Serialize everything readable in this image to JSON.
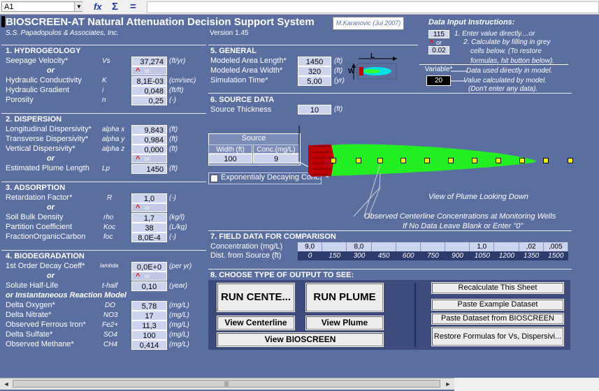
{
  "formula_bar": {
    "cell_ref": "A1",
    "dropdown": "▼",
    "fx_icon": "fx",
    "sum_icon": "Σ",
    "equals_icon": "="
  },
  "header": {
    "title": "BIOSCREEN-AT Natural Attenuation Decision Support System",
    "company": "S.S. Papadopulos & Associates, Inc.",
    "version": "Version 1.45",
    "author": "M.Karanovic (Jul 2007)"
  },
  "instructions": {
    "title": "Data Input Instructions:",
    "example_value": "115",
    "or": "or",
    "example_calc": "0.02",
    "step1": "1.  Enter value directly....or",
    "step2a": "2.  Calculate by filling in grey",
    "step2b": "cells below.  (To restore",
    "step2c": "formulas, hit button below).",
    "variable_label": "Variable*",
    "variable_note": "Data used directly in model.",
    "calc_value": "20",
    "calc_note1": "Value calculated by model.",
    "calc_note2": "(Don't enter any data)."
  },
  "hydrogeology": {
    "header": "1.  HYDROGEOLOGY",
    "seepage_label": "Seepage Velocity*",
    "seepage_sym": "Vs",
    "seepage_value": "37,274",
    "seepage_unit": "(ft/yr)",
    "or": "or",
    "or_small": "or",
    "conductivity_label": "Hydraulic Conductivity",
    "conductivity_sym": "K",
    "conductivity_value": "8,1E-03",
    "conductivity_unit": "(cm/sec)",
    "gradient_label": "Hydraulic Gradient",
    "gradient_sym": "i",
    "gradient_value": "0,048",
    "gradient_unit": "(ft/ft)",
    "porosity_label": "Porosity",
    "porosity_sym": "n",
    "porosity_value": "0,25",
    "porosity_unit": "(-)"
  },
  "dispersion": {
    "header": "2.  DISPERSION",
    "long_label": "Longitudinal Dispersivity*",
    "long_sym": "alpha x",
    "long_value": "9,843",
    "long_unit": "(ft)",
    "trans_label": "Transverse Dispersivity*",
    "trans_sym": "alpha y",
    "trans_value": "0,984",
    "trans_unit": "(ft)",
    "vert_label": "Vertical Dispersivity*",
    "vert_sym": "alpha z",
    "vert_value": "0,000",
    "vert_unit": "(ft)",
    "or": "or",
    "or_small": "or",
    "plume_label": "Estimated Plume Length",
    "plume_sym": "Lp",
    "plume_value": "1450",
    "plume_unit": "(ft)"
  },
  "adsorption": {
    "header": "3.  ADSORPTION",
    "retard_label": "Retardation Factor*",
    "retard_sym": "R",
    "retard_value": "1,0",
    "retard_unit": "(-)",
    "or": "or",
    "or_small": "or",
    "bulk_label": "Soil Bulk Density",
    "bulk_sym": "rho",
    "bulk_value": "1,7",
    "bulk_unit": "(kg/l)",
    "partition_label": "Partition Coefficient",
    "partition_sym": "Koc",
    "partition_value": "38",
    "partition_unit": "(L/kg)",
    "foc_label": "FractionOrganicCarbon",
    "foc_sym": "foc",
    "foc_value": "8,0E-4",
    "foc_unit": "(-)"
  },
  "biodegradation": {
    "header": "4.  BIODEGRADATION",
    "decay_label": "1st Order Decay Coeff*",
    "decay_sym": "lambda",
    "decay_value": "0,0E+0",
    "decay_unit": "(per yr)",
    "or": "or",
    "or_small": "or",
    "halflife_label": "Solute Half-Life",
    "halflife_sym": "t-half",
    "halflife_value": "0,10",
    "halflife_unit": "(year)",
    "inst_label": "or Instantaneous Reaction Model",
    "do_label": "Delta Oxygen*",
    "do_sym": "DO",
    "do_value": "5,78",
    "do_unit": "(mg/L)",
    "no3_label": "Delta Nitrate*",
    "no3_sym": "NO3",
    "no3_value": "17",
    "no3_unit": "(mg/L)",
    "fe_label": "Observed Ferrous Iron*",
    "fe_sym": "Fe2+",
    "fe_value": "11,3",
    "fe_unit": "(mg/L)",
    "so4_label": "Delta Sulfate*",
    "so4_sym": "SO4",
    "so4_value": "100",
    "so4_unit": "(mg/L)",
    "ch4_label": "Observed Methane*",
    "ch4_sym": "CH4",
    "ch4_value": "0,414",
    "ch4_unit": "(mg/L)"
  },
  "general": {
    "header": "5.  GENERAL",
    "length_label": "Modeled Area Length*",
    "length_value": "1450",
    "length_unit": "(ft)",
    "width_label": "Modeled Area Width*",
    "width_value": "320",
    "width_unit": "(ft)",
    "time_label": "Simulation Time*",
    "time_value": "5,00",
    "time_unit": "(yr)",
    "diagram_L": "L",
    "diagram_W": "W"
  },
  "source": {
    "header": "6.  SOURCE DATA",
    "thickness_label": "Source Thickness",
    "thickness_value": "10",
    "thickness_unit": "(ft)",
    "table_title": "Source",
    "col_width": "Width (ft)",
    "col_conc": "Conc.(mg/L)",
    "width_value": "100",
    "conc_value": "9",
    "exp_checkbox": "Exponentialy Decaying Conc."
  },
  "plume_view": {
    "caption": "View of Plume Looking Down",
    "obs1": "Observed Centerline Concentrations at Monitoring Wells",
    "obs2": "If No Data Leave Blank or Enter \"0\""
  },
  "field_data": {
    "header": "7.  FIELD DATA FOR COMPARISON",
    "conc_label": "Concentration (mg/L)",
    "dist_label": "Dist. from Source  (ft)",
    "concentrations": [
      "9,0",
      "",
      "8,0",
      "",
      "",
      "",
      "",
      "1,0",
      "",
      ",02",
      ",005"
    ],
    "distances": [
      "0",
      "150",
      "300",
      "450",
      "600",
      "750",
      "900",
      "1050",
      "1200",
      "1350",
      "1500"
    ]
  },
  "output": {
    "header": "8.  CHOOSE TYPE OF OUTPUT TO SEE:",
    "run_centerline": "RUN CENTE...",
    "run_plume": "RUN PLUME",
    "view_centerline": "View Centerline",
    "view_plume": "View Plume",
    "view_bioscreen": "View BIOSCREEN",
    "recalc": "Recalculate This Sheet",
    "paste_example": "Paste Example Dataset",
    "paste_bioscreen": "Paste Dataset from BIOSCREEN",
    "restore": "Restore Formulas for Vs, Dispersivi..."
  },
  "scroll": {
    "left_arrow": "◄",
    "right_arrow": "►",
    "thumb_grip": "|||"
  }
}
